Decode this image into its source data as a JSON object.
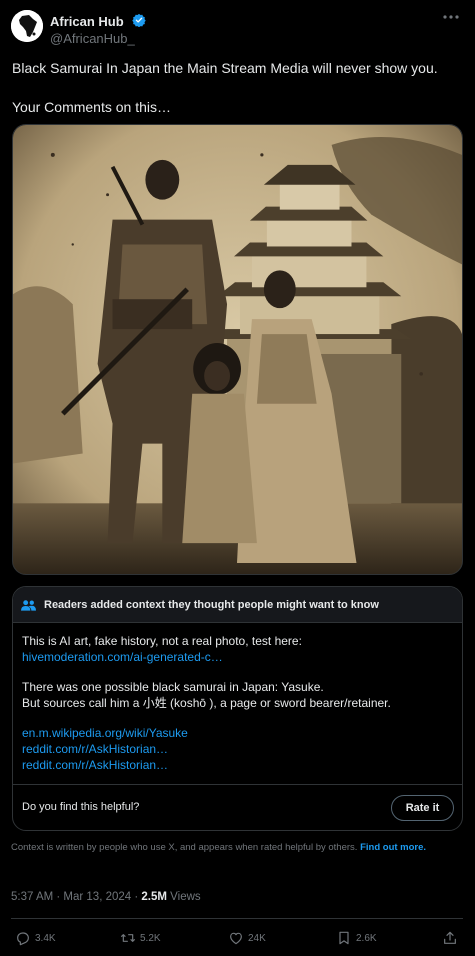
{
  "author": {
    "name": "African Hub",
    "handle": "@AfricanHub_"
  },
  "tweet": {
    "line1": "Black Samurai In Japan the Main Stream Media will never show you.",
    "line2": "Your Comments on this…"
  },
  "media": {
    "alt": "sepia photo of a samurai family in front of a castle"
  },
  "note": {
    "title": "Readers added context they thought people might want to know",
    "p1": "This is AI art, fake history, not a real photo, test here:",
    "link1": "hivemoderation.com/ai-generated-c…",
    "p2a": "There was one possible black samurai in Japan: Yasuke.",
    "p2b": "But sources call him a  小姓 (koshō ), a page or sword bearer/retainer.",
    "link2": "en.m.wikipedia.org/wiki/Yasuke",
    "link3": "reddit.com/r/AskHistorian…",
    "link4": "reddit.com/r/AskHistorian…",
    "question": "Do you find this helpful?",
    "rate_label": "Rate it"
  },
  "disclaimer": {
    "text": "Context is written by people who use X, and appears when rated helpful by others.",
    "link": "Find out more."
  },
  "meta": {
    "time": "5:37 AM · Mar 13, 2024 · ",
    "views_count": "2.5M",
    "views_label": " Views"
  },
  "actions": {
    "replies": "3.4K",
    "reposts": "5.2K",
    "likes": "24K",
    "bookmarks": "2.6K"
  },
  "icons": [
    "verified-badge-icon",
    "more-icon",
    "people-icon",
    "reply-icon",
    "repost-icon",
    "like-icon",
    "bookmark-icon",
    "share-icon"
  ],
  "colors": {
    "accent": "#1d9bf0",
    "text": "#e7e9ea",
    "muted": "#71767b",
    "border": "#2f3336"
  }
}
